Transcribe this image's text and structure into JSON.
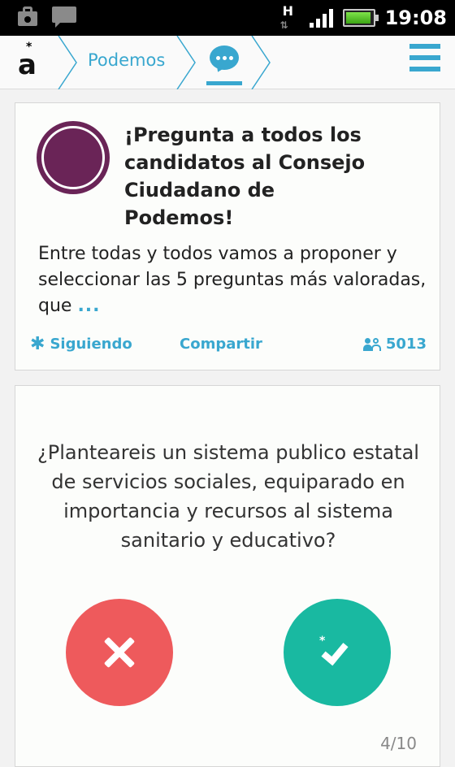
{
  "status_bar": {
    "network_type": "H",
    "time": "19:08",
    "battery_level": 0.95,
    "signal_bars": 4,
    "icons": [
      "shopping-bag-icon",
      "message-icon",
      "network-arrows-icon",
      "signal-icon",
      "battery-icon"
    ]
  },
  "header": {
    "logo_text": "a",
    "logo_star": "*",
    "breadcrumb_label": "Podemos",
    "active_tab_icon": "chat-bubble-icon",
    "menu_icon": "hamburger-menu-icon",
    "accent_color": "#39a7cf"
  },
  "card": {
    "title": "¡Pregunta a todos los candidatos al Consejo Ciudadano de Podemos!",
    "description": "Entre todas y todos vamos a proponer y seleccionar las 5 preguntas más valoradas, que",
    "more": "...",
    "follow_label": "Siguiendo",
    "share_label": "Compartir",
    "participants": "5013",
    "avatar_color": "#6a2457"
  },
  "question_card": {
    "question": "¿Planteareis un sistema publico estatal de servicios sociales, equiparado en importancia y recursos al sistema sanitario y educativo?",
    "no_color": "#ee5a5c",
    "yes_color": "#19b9a1",
    "progress": "4/10"
  }
}
